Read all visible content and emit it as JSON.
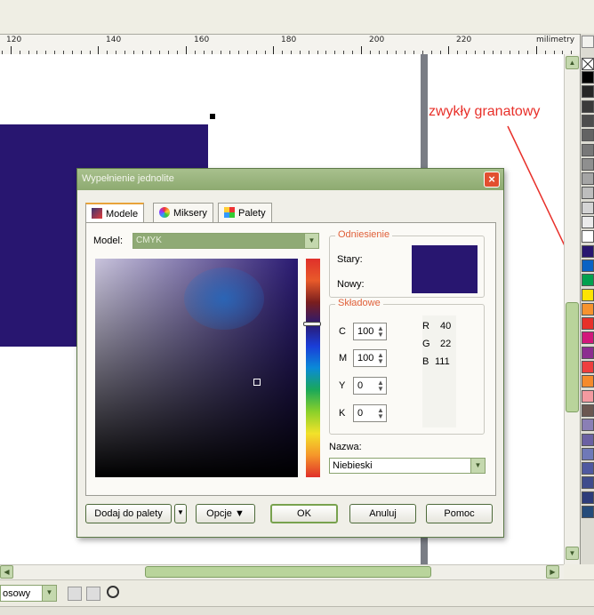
{
  "ruler": {
    "labels": [
      "120",
      "140",
      "160",
      "180",
      "200",
      "220",
      "milimetry"
    ]
  },
  "annotation": {
    "text": "zwykły granatowy",
    "color": "#e8302a"
  },
  "palette": {
    "swatches": [
      "#000000",
      "#262626",
      "#3a3a3a",
      "#4d4d4d",
      "#636363",
      "#787878",
      "#8f8f8f",
      "#a5a5a5",
      "#bdbdbd",
      "#d4d4d4",
      "#ebebeb",
      "#ffffff",
      "#281670",
      "#0a62c4",
      "#00a14f",
      "#fde404",
      "#f7932f",
      "#e8302a",
      "#d2187b",
      "#8c2d90",
      "#ee3e3e",
      "#f58a2c",
      "#f39aa0",
      "#6b5751",
      "#8a7fb5",
      "#6b61a3",
      "#6f79b8",
      "#4f59a0",
      "#3f4c8c",
      "#2d3c7a",
      "#254b7a"
    ]
  },
  "dialog": {
    "title": "Wypełnienie jednolite",
    "close_icon": "×",
    "tabs": [
      {
        "label": "Modele",
        "icon": "model-icon"
      },
      {
        "label": "Miksery",
        "icon": "mixer-icon"
      },
      {
        "label": "Palety",
        "icon": "palette-icon"
      }
    ],
    "model_label": "Model:",
    "model_value": "CMYK",
    "reference": {
      "title": "Odniesienie",
      "old_label": "Stary:",
      "new_label": "Nowy:",
      "old_color": "#281670",
      "new_color": "#281670"
    },
    "components": {
      "title": "Składowe",
      "c_label": "C",
      "c_value": "100",
      "m_label": "M",
      "m_value": "100",
      "y_label": "Y",
      "y_value": "0",
      "k_label": "K",
      "k_value": "0",
      "r_label": "R",
      "r_value": "40",
      "g_label": "G",
      "g_value": "22",
      "b_label": "B",
      "b_value": "111"
    },
    "name_label": "Nazwa:",
    "name_value": "Niebieski",
    "buttons": {
      "add_to_palette": "Dodaj do palety",
      "options": "Opcje ▼",
      "ok": "OK",
      "cancel": "Anuluj",
      "help": "Pomoc"
    }
  },
  "bottombar": {
    "mode_text": "osowy"
  }
}
